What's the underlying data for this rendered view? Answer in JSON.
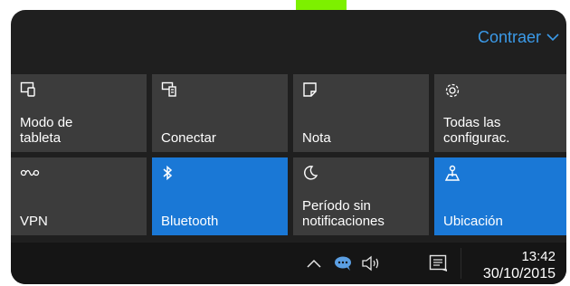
{
  "accent_color": "#7df000",
  "header": {
    "collapse_label": "Contraer",
    "collapse_icon": "chevron-down-icon",
    "collapse_color": "#3b9ae8"
  },
  "tiles": [
    {
      "label": "Modo de\ntableta",
      "icon": "tablet-mode-icon",
      "active": false
    },
    {
      "label": "Conectar",
      "icon": "connect-icon",
      "active": false
    },
    {
      "label": "Nota",
      "icon": "note-icon",
      "active": false
    },
    {
      "label": "Todas las\nconfigurac.",
      "icon": "gear-icon",
      "active": false
    },
    {
      "label": "VPN",
      "icon": "vpn-icon",
      "active": false
    },
    {
      "label": "Bluetooth",
      "icon": "bluetooth-icon",
      "active": true
    },
    {
      "label": "Período sin\nnotificaciones",
      "icon": "moon-icon",
      "active": false
    },
    {
      "label": "Ubicación",
      "icon": "location-icon",
      "active": true
    }
  ],
  "taskbar": {
    "tray_icons": [
      "chevron-up-icon",
      "chat-icon",
      "volume-icon"
    ],
    "notification_icon": "action-center-icon",
    "time": "13:42",
    "date": "30/10/2015"
  },
  "colors": {
    "tile_inactive": "#3c3c3c",
    "tile_active": "#1a78d6",
    "panel_bg": "#1f1f1f"
  }
}
